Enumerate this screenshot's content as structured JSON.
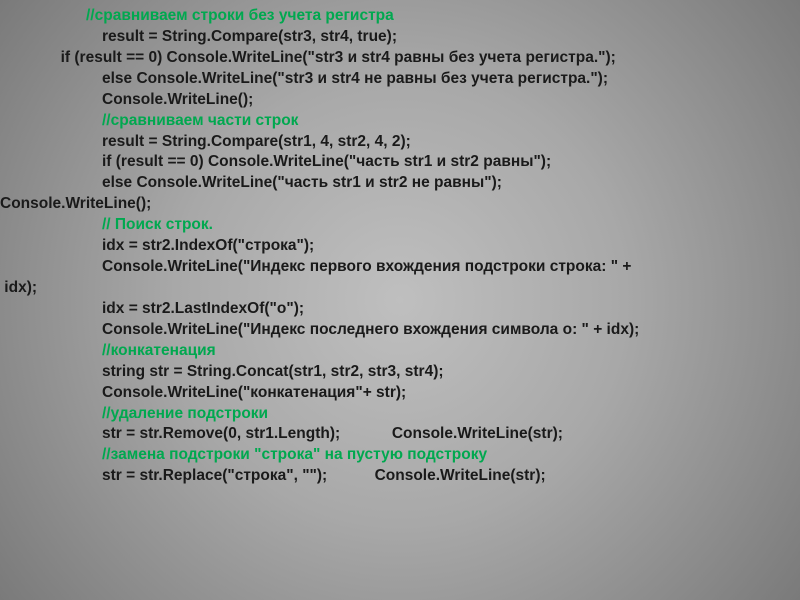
{
  "lines": [
    {
      "cls": "c pad1",
      "text": "//сравниваем строки без учета регистра"
    },
    {
      "cls": "t pad3",
      "text": "result = String.Compare(str3, str4, true);"
    },
    {
      "cls": "t pad4",
      "text": "  if (result == 0) Console.WriteLine(\"str3 и str4 равны без учета регистра.\");"
    },
    {
      "cls": "t pad3",
      "text": "else Console.WriteLine(\"str3 и str4 не равны без учета регистра.\");"
    },
    {
      "cls": "t pad3",
      "text": "Console.WriteLine();"
    },
    {
      "cls": "c pad3",
      "text": "//сравниваем части строк"
    },
    {
      "cls": "t pad3",
      "text": "result = String.Compare(str1, 4, str2, 4, 2);"
    },
    {
      "cls": "t pad3",
      "text": "if (result == 0) Console.WriteLine(\"часть str1 и str2 равны\");"
    },
    {
      "cls": "t pad3",
      "text": "else Console.WriteLine(\"часть str1 и str2 не равны\");"
    },
    {
      "cls": "t",
      "text": "Console.WriteLine();"
    },
    {
      "cls": "c pad3",
      "text": "// Поиск строк."
    },
    {
      "cls": "t pad3",
      "text": "idx = str2.IndexOf(\"строка\");"
    },
    {
      "cls": "t pad3",
      "text": "Console.WriteLine(\"Индекс первого вхождения подстроки строка: \" +"
    },
    {
      "cls": "t",
      "text": " idx);"
    },
    {
      "cls": "t pad3",
      "text": "idx = str2.LastIndexOf(\"о\");"
    },
    {
      "cls": "t pad3",
      "text": "Console.WriteLine(\"Индекс последнего вхождения символа о: \" + idx);"
    },
    {
      "cls": "c pad3",
      "text": "//конкатенация"
    },
    {
      "cls": "t pad3",
      "text": "string str = String.Concat(str1, str2, str3, str4);"
    },
    {
      "cls": "t pad3",
      "text": "Console.WriteLine(\"конкатенация\"+ str);"
    },
    {
      "cls": "c pad3",
      "text": "//удаление подстроки"
    },
    {
      "cls": "t pad3",
      "text": "str = str.Remove(0, str1.Length);            Console.WriteLine(str);"
    },
    {
      "cls": "c pad3",
      "text": "//замена подстроки \"строка\" на пустую подстроку"
    },
    {
      "cls": "t pad3",
      "text": "str = str.Replace(\"строка\", \"\");           Console.WriteLine(str);"
    }
  ]
}
